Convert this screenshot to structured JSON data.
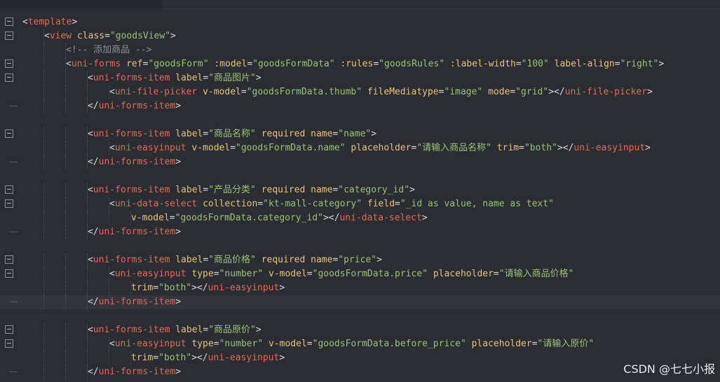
{
  "editor": {
    "lines": [
      {
        "fold": "open",
        "indent": 0,
        "parts": [
          [
            "p",
            "<"
          ],
          [
            "t",
            "template"
          ],
          [
            "p",
            ">"
          ]
        ]
      },
      {
        "fold": "open",
        "indent": 1,
        "parts": [
          [
            "p",
            "<"
          ],
          [
            "t",
            "view "
          ],
          [
            "a",
            "class"
          ],
          [
            "p",
            "="
          ],
          [
            "s",
            "\"goodsView\""
          ],
          [
            "p",
            ">"
          ]
        ]
      },
      {
        "fold": "none",
        "indent": 2,
        "parts": [
          [
            "c",
            "<!-- 添加商品 -->"
          ]
        ]
      },
      {
        "fold": "open",
        "indent": 2,
        "parts": [
          [
            "p",
            "<"
          ],
          [
            "t",
            "uni-forms "
          ],
          [
            "a",
            "ref"
          ],
          [
            "p",
            "="
          ],
          [
            "s",
            "\"goodsForm\""
          ],
          [
            "p",
            " "
          ],
          [
            "a",
            ":model"
          ],
          [
            "p",
            "="
          ],
          [
            "s",
            "\"goodsFormData\""
          ],
          [
            "p",
            " "
          ],
          [
            "a",
            ":rules"
          ],
          [
            "p",
            "="
          ],
          [
            "s",
            "\"goodsRules\""
          ],
          [
            "p",
            " "
          ],
          [
            "a",
            ":label-width"
          ],
          [
            "p",
            "="
          ],
          [
            "s",
            "\"100\""
          ],
          [
            "p",
            " "
          ],
          [
            "a",
            "label-align"
          ],
          [
            "p",
            "="
          ],
          [
            "s",
            "\"right\""
          ],
          [
            "p",
            ">"
          ]
        ]
      },
      {
        "fold": "open",
        "indent": 3,
        "parts": [
          [
            "p",
            "<"
          ],
          [
            "t",
            "uni-forms-item "
          ],
          [
            "a",
            "label"
          ],
          [
            "p",
            "="
          ],
          [
            "s",
            "\"商品图片\""
          ],
          [
            "p",
            ">"
          ]
        ]
      },
      {
        "fold": "none",
        "indent": 4,
        "parts": [
          [
            "p",
            "<"
          ],
          [
            "t",
            "uni-file-picker "
          ],
          [
            "a",
            "v-model"
          ],
          [
            "p",
            "="
          ],
          [
            "s",
            "\"goodsFormData.thumb\""
          ],
          [
            "p",
            " "
          ],
          [
            "a",
            "fileMediatype"
          ],
          [
            "p",
            "="
          ],
          [
            "s",
            "\"image\""
          ],
          [
            "p",
            " "
          ],
          [
            "a",
            "mode"
          ],
          [
            "p",
            "="
          ],
          [
            "s",
            "\"grid\""
          ],
          [
            "p",
            "></"
          ],
          [
            "t",
            "uni-file-picker"
          ],
          [
            "p",
            ">"
          ]
        ]
      },
      {
        "fold": "end",
        "indent": 3,
        "parts": [
          [
            "p",
            "</"
          ],
          [
            "t",
            "uni-forms-item"
          ],
          [
            "p",
            ">"
          ]
        ]
      },
      {
        "fold": "none",
        "indent": 0,
        "parts": []
      },
      {
        "fold": "open",
        "indent": 3,
        "parts": [
          [
            "p",
            "<"
          ],
          [
            "t",
            "uni-forms-item "
          ],
          [
            "a",
            "label"
          ],
          [
            "p",
            "="
          ],
          [
            "s",
            "\"商品名称\""
          ],
          [
            "p",
            " "
          ],
          [
            "a",
            "required"
          ],
          [
            "p",
            " "
          ],
          [
            "a",
            "name"
          ],
          [
            "p",
            "="
          ],
          [
            "s",
            "\"name\""
          ],
          [
            "p",
            ">"
          ]
        ]
      },
      {
        "fold": "none",
        "indent": 4,
        "parts": [
          [
            "p",
            "<"
          ],
          [
            "t",
            "uni-easyinput "
          ],
          [
            "a",
            "v-model"
          ],
          [
            "p",
            "="
          ],
          [
            "s",
            "\"goodsFormData.name\""
          ],
          [
            "p",
            " "
          ],
          [
            "a",
            "placeholder"
          ],
          [
            "p",
            "="
          ],
          [
            "s",
            "\"请输入商品名称\""
          ],
          [
            "p",
            " "
          ],
          [
            "a",
            "trim"
          ],
          [
            "p",
            "="
          ],
          [
            "s",
            "\"both\""
          ],
          [
            "p",
            "></"
          ],
          [
            "t",
            "uni-easyinput"
          ],
          [
            "p",
            ">"
          ]
        ]
      },
      {
        "fold": "end",
        "indent": 3,
        "parts": [
          [
            "p",
            "</"
          ],
          [
            "t",
            "uni-forms-item"
          ],
          [
            "p",
            ">"
          ]
        ]
      },
      {
        "fold": "none",
        "indent": 0,
        "parts": []
      },
      {
        "fold": "open",
        "indent": 3,
        "parts": [
          [
            "p",
            "<"
          ],
          [
            "t",
            "uni-forms-item "
          ],
          [
            "a",
            "label"
          ],
          [
            "p",
            "="
          ],
          [
            "s",
            "\"产品分类\""
          ],
          [
            "p",
            " "
          ],
          [
            "a",
            "required"
          ],
          [
            "p",
            " "
          ],
          [
            "a",
            "name"
          ],
          [
            "p",
            "="
          ],
          [
            "s",
            "\"category_id\""
          ],
          [
            "p",
            ">"
          ]
        ]
      },
      {
        "fold": "open",
        "indent": 4,
        "parts": [
          [
            "p",
            "<"
          ],
          [
            "t",
            "uni-data-select "
          ],
          [
            "a",
            "collection"
          ],
          [
            "p",
            "="
          ],
          [
            "s",
            "\"kt-mall-category\""
          ],
          [
            "p",
            " "
          ],
          [
            "a",
            "field"
          ],
          [
            "p",
            "="
          ],
          [
            "s",
            "\"_id as value, name as text\""
          ]
        ]
      },
      {
        "fold": "none",
        "indent": 5,
        "parts": [
          [
            "a",
            "v-model"
          ],
          [
            "p",
            "="
          ],
          [
            "s",
            "\"goodsFormData.category_id\""
          ],
          [
            "p",
            "></"
          ],
          [
            "t",
            "uni-data-select"
          ],
          [
            "p",
            ">"
          ]
        ]
      },
      {
        "fold": "end",
        "indent": 3,
        "parts": [
          [
            "p",
            "</"
          ],
          [
            "t",
            "uni-forms-item"
          ],
          [
            "p",
            ">"
          ]
        ]
      },
      {
        "fold": "none",
        "indent": 0,
        "parts": []
      },
      {
        "fold": "open",
        "indent": 3,
        "parts": [
          [
            "p",
            "<"
          ],
          [
            "t",
            "uni-forms-item "
          ],
          [
            "a",
            "label"
          ],
          [
            "p",
            "="
          ],
          [
            "s",
            "\"商品价格\""
          ],
          [
            "p",
            " "
          ],
          [
            "a",
            "required"
          ],
          [
            "p",
            " "
          ],
          [
            "a",
            "name"
          ],
          [
            "p",
            "="
          ],
          [
            "s",
            "\"price\""
          ],
          [
            "p",
            ">"
          ]
        ]
      },
      {
        "fold": "open",
        "indent": 4,
        "parts": [
          [
            "p",
            "<"
          ],
          [
            "t",
            "uni-easyinput "
          ],
          [
            "a",
            "type"
          ],
          [
            "p",
            "="
          ],
          [
            "s",
            "\"number\""
          ],
          [
            "p",
            " "
          ],
          [
            "a",
            "v-model"
          ],
          [
            "p",
            "="
          ],
          [
            "s",
            "\"goodsFormData.price\""
          ],
          [
            "p",
            " "
          ],
          [
            "a",
            "placeholder"
          ],
          [
            "p",
            "="
          ],
          [
            "s",
            "\"请输入商品价格\""
          ]
        ]
      },
      {
        "fold": "none",
        "indent": 5,
        "parts": [
          [
            "a",
            "trim"
          ],
          [
            "p",
            "="
          ],
          [
            "s",
            "\"both\""
          ],
          [
            "p",
            "></"
          ],
          [
            "t",
            "uni-easyinput"
          ],
          [
            "p",
            ">"
          ]
        ]
      },
      {
        "fold": "end",
        "indent": 3,
        "highlight": true,
        "parts": [
          [
            "p",
            "</"
          ],
          [
            "t",
            "uni-forms-item"
          ],
          [
            "p",
            ">"
          ]
        ]
      },
      {
        "fold": "none",
        "indent": 0,
        "parts": []
      },
      {
        "fold": "open",
        "indent": 3,
        "parts": [
          [
            "p",
            "<"
          ],
          [
            "t",
            "uni-forms-item "
          ],
          [
            "a",
            "label"
          ],
          [
            "p",
            "="
          ],
          [
            "s",
            "\"商品原价\""
          ],
          [
            "p",
            ">"
          ]
        ]
      },
      {
        "fold": "open",
        "indent": 4,
        "parts": [
          [
            "p",
            "<"
          ],
          [
            "t",
            "uni-easyinput "
          ],
          [
            "a",
            "type"
          ],
          [
            "p",
            "="
          ],
          [
            "s",
            "\"number\""
          ],
          [
            "p",
            " "
          ],
          [
            "a",
            "v-model"
          ],
          [
            "p",
            "="
          ],
          [
            "s",
            "\"goodsFormData.before_price\""
          ],
          [
            "p",
            " "
          ],
          [
            "a",
            "placeholder"
          ],
          [
            "p",
            "="
          ],
          [
            "s",
            "\"请输入原价\""
          ]
        ]
      },
      {
        "fold": "none",
        "indent": 5,
        "parts": [
          [
            "a",
            "trim"
          ],
          [
            "p",
            "="
          ],
          [
            "s",
            "\"both\""
          ],
          [
            "p",
            "></"
          ],
          [
            "t",
            "uni-easyinput"
          ],
          [
            "p",
            ">"
          ]
        ]
      },
      {
        "fold": "end",
        "indent": 3,
        "parts": [
          [
            "p",
            "</"
          ],
          [
            "t",
            "uni-forms-item"
          ],
          [
            "p",
            ">"
          ]
        ]
      }
    ]
  },
  "watermark": "CSDN @七七小报"
}
